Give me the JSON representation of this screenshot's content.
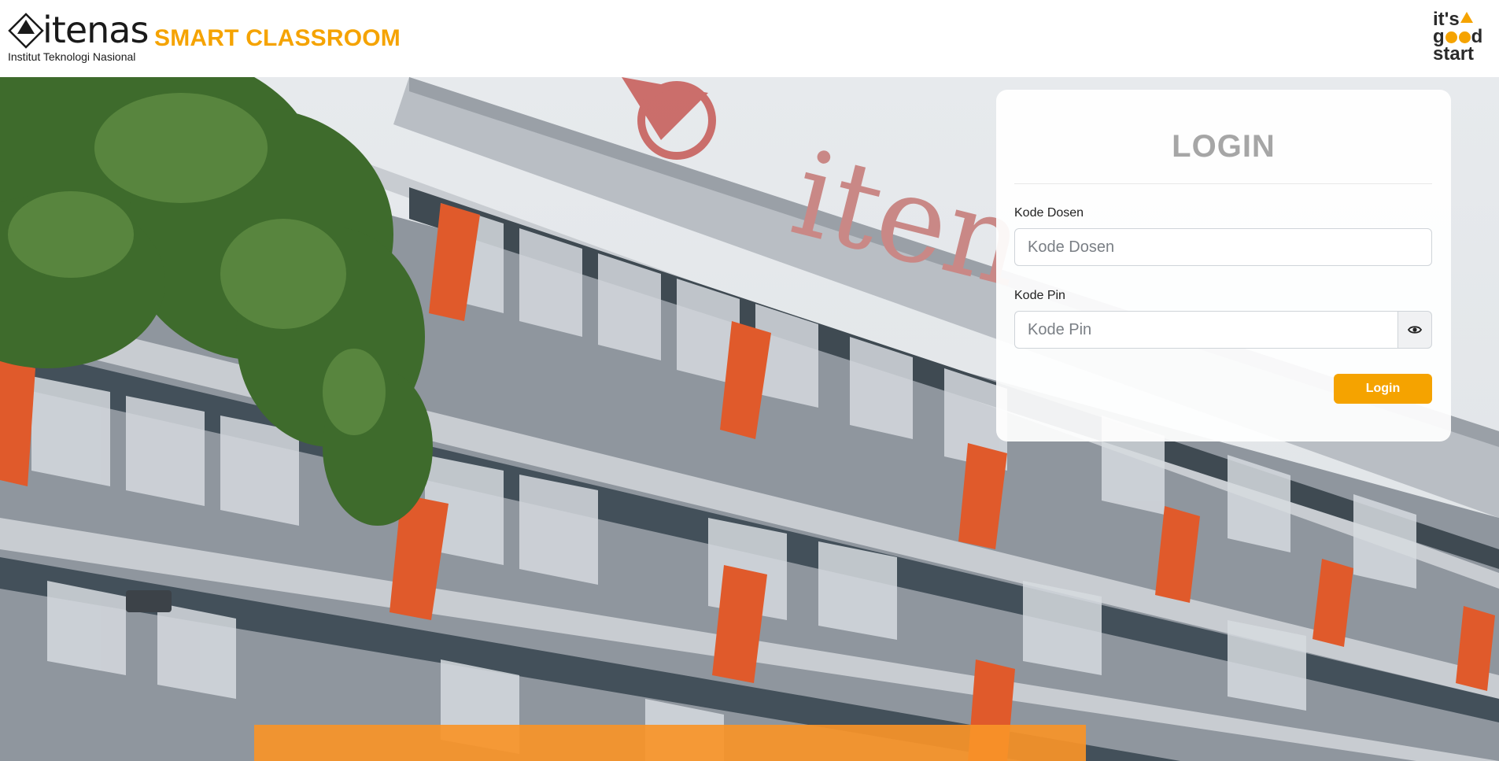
{
  "header": {
    "logo_word": "itenas",
    "logo_subtitle": "Institut Teknologi Nasional",
    "app_title": "SMART CLASSROOM",
    "tagline": {
      "line1": "it's",
      "line2_start": "g",
      "line2_end": "d",
      "line3": "start"
    }
  },
  "background": {
    "building_sign": "iten"
  },
  "login": {
    "title": "LOGIN",
    "kode_dosen_label": "Kode Dosen",
    "kode_dosen_placeholder": "Kode Dosen",
    "kode_dosen_value": "",
    "kode_pin_label": "Kode Pin",
    "kode_pin_placeholder": "Kode Pin",
    "kode_pin_value": "",
    "toggle_icon": "eye-icon",
    "submit_label": "Login"
  },
  "colors": {
    "accent": "#f5a300",
    "bottom_bar": "#f99428",
    "title_gray": "#a6a6a6"
  }
}
